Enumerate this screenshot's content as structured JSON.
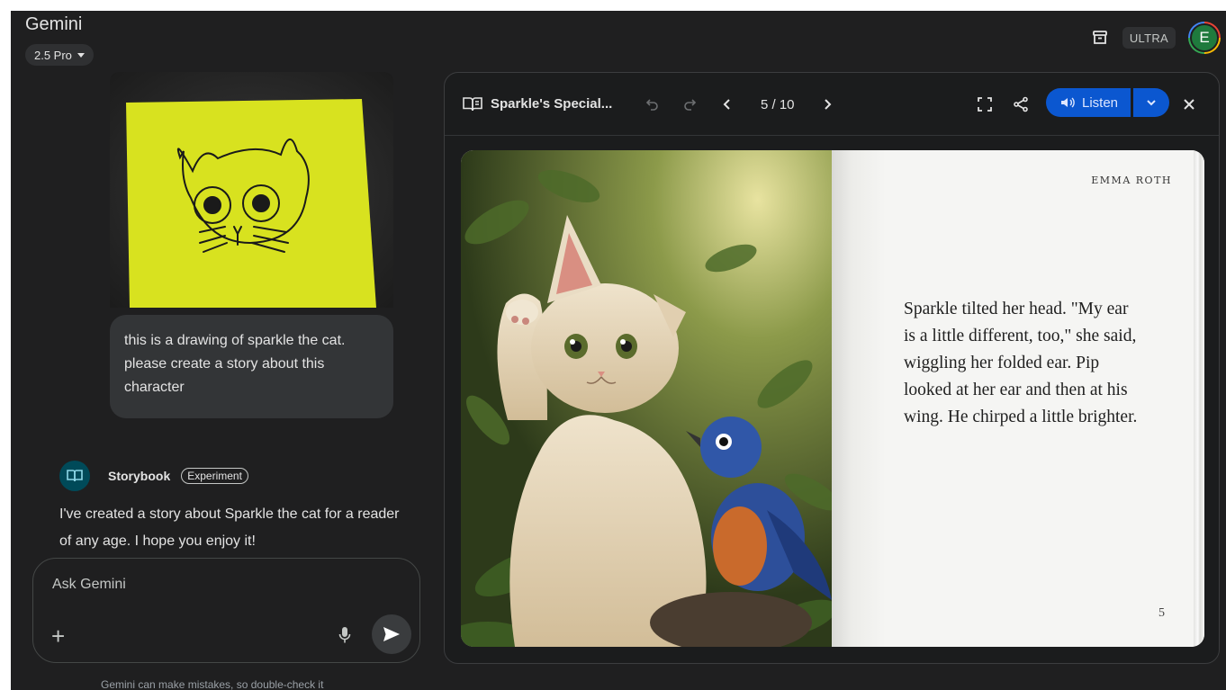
{
  "app": {
    "title": "Gemini",
    "model": "2.5 Pro",
    "plan_badge": "ULTRA",
    "avatar_letter": "E"
  },
  "chat": {
    "user_message": "this is a drawing of sparkle the cat. please create a story about this character",
    "assistant": {
      "tool_name": "Storybook",
      "tool_badge": "Experiment",
      "reply": "I've created a story about Sparkle the cat for a reader of any age. I hope you enjoy it!"
    },
    "composer": {
      "placeholder": "Ask Gemini"
    },
    "disclaimer": "Gemini can make mistakes, so double-check it"
  },
  "storybook": {
    "title": "Sparkle's Special...",
    "page_indicator": "5 / 10",
    "listen_label": "Listen",
    "author": "EMMA ROTH",
    "page_text": "Sparkle tilted her head. \"My ear is a little different, too,\" she said, wiggling her folded ear. Pip looked at her ear and then at his wing. He chirped a little brighter.",
    "page_number": "5"
  },
  "colors": {
    "background": "#1f1f20",
    "accent": "#0b57d0",
    "sticky_note": "#d8e21f",
    "storybook_icon_bg": "#004a59"
  }
}
